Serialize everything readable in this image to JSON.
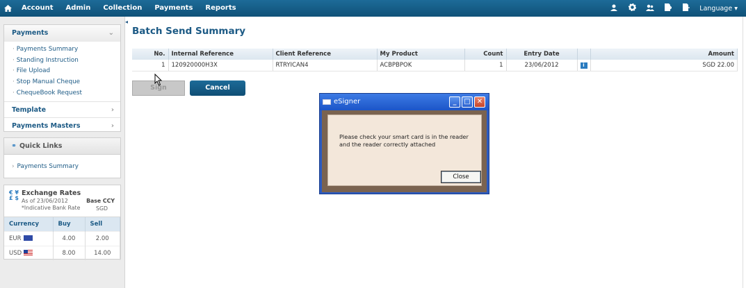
{
  "topnav": {
    "menu": [
      "Account",
      "Admin",
      "Collection",
      "Payments",
      "Reports"
    ],
    "language": "Language"
  },
  "sidebar": {
    "payments_title": "Payments",
    "payments_items": [
      "Payments Summary",
      "Standing Instruction",
      "File Upload",
      "Stop Manual Cheque",
      "ChequeBook Request"
    ],
    "template": "Template",
    "payments_masters": "Payments Masters",
    "quick_links_title": "Quick Links",
    "quick_links_items": [
      "Payments Summary"
    ],
    "fx": {
      "symbols": "€ ¥\n£ $",
      "title": "Exchange Rates",
      "as_of": "As of 23/06/2012",
      "indicative": "*Indicative Bank Rate",
      "base_label": "Base CCY",
      "base_value": "SGD",
      "headers": [
        "Currency",
        "Buy",
        "Sell"
      ],
      "rows": [
        {
          "currency": "EUR",
          "buy": "4.00",
          "sell": "2.00"
        },
        {
          "currency": "USD",
          "buy": "8.00",
          "sell": "14.00"
        }
      ]
    }
  },
  "main": {
    "title": "Batch Send Summary",
    "table": {
      "headers": [
        "No.",
        "Internal Reference",
        "Client Reference",
        "My Product",
        "Count",
        "Entry Date",
        "",
        "Amount"
      ],
      "rows": [
        {
          "no": "1",
          "internal_ref": "120920000H3X",
          "client_ref": "RTRYICAN4",
          "product": "ACBPBPOK",
          "count": "1",
          "entry_date": "23/06/2012",
          "amount": "SGD 22.00"
        }
      ]
    },
    "sign_label": "Sign",
    "cancel_label": "Cancel"
  },
  "dialog": {
    "title": "eSigner",
    "message": "Please check your smart card is in the reader and the reader correctly attached",
    "close_label": "Close"
  },
  "colors": {
    "nav_bg": "#15608c",
    "accent": "#1c5a85",
    "dialog_title": "#2d5bbf"
  }
}
